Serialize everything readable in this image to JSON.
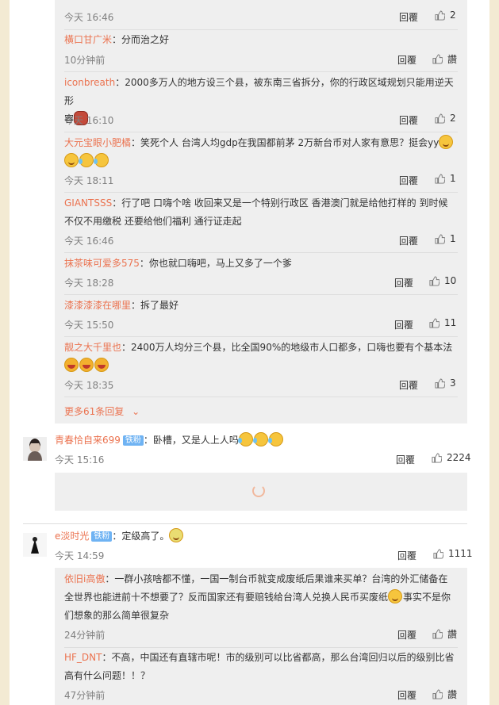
{
  "labels": {
    "reply": "回覆",
    "like": "讚"
  },
  "replies1": [
    {
      "user": "",
      "text": "",
      "time": "今天 16:46",
      "likes": "2"
    },
    {
      "user": "橫口甘广米",
      "text": "：分而治之好",
      "time": "10分钟前",
      "likes": "讚"
    },
    {
      "user": "iconbreath",
      "text": "：2000多万人的地方设三个县，被东南三省拆分，你的行政区域规划只能用逆天形",
      "text2": "容",
      "time": "今天 16:10",
      "likes": "2"
    },
    {
      "user": "大元宝眼小肥橘",
      "text": "：笑死个人 台湾人均gdp在我国都前茅 2万新台币对人家有意思？挺会yy",
      "time": "今天 18:11",
      "likes": "1"
    },
    {
      "user": "GIANTSSS",
      "text": "：行了吧  口嗨个啥  收回来又是一个特别行政区 香港澳门就是给他打样的  到时候",
      "text2": "不仅不用缴税 还要给他们福利  通行证走起",
      "time": "今天 16:46",
      "likes": "1"
    },
    {
      "user": "抹茶味可爱多575",
      "text": "：你也就口嗨吧，马上又多了一个爹",
      "time": "今天 18:28",
      "likes": "10"
    },
    {
      "user": "漆漆漆漆在哪里",
      "text": "：拆了最好",
      "time": "今天 15:50",
      "likes": "11"
    },
    {
      "user": "靓之大千里也",
      "text": "：2400万人均分三个县，比全国90%的地级市人口都多，口嗨也要有个基本法",
      "time": "今天 18:35",
      "likes": "3"
    }
  ],
  "more_replies": "更多61条回复",
  "comment1": {
    "user": "青春恰自来699",
    "badge": "铁粉",
    "text": "：卧槽，又是人上人吗",
    "time": "今天 15:16",
    "likes": "2224"
  },
  "comment2": {
    "user": "e淡时光",
    "badge": "铁粉",
    "text": "：定级高了。",
    "time": "今天 14:59",
    "likes": "1111"
  },
  "replies2": [
    {
      "user": "依旧i高傲",
      "text": "：一群小孩啥都不懂，一国一制台币就变成废纸后果谁来买单？台湾的外汇储备在",
      "text2": "全世界也能进前十不想要了？反而国家还有要赔钱给台湾人兑换人民币买废纸",
      "text2b": "事实不是你",
      "text3": "们想象的那么简单很复杂",
      "time": "24分钟前",
      "likes": "讚"
    },
    {
      "user": "HF_DNT",
      "text": "：不高，中国还有直辖市呢！市的级别可以比省都高，那么台湾回归以后的级别比省",
      "text2": "高有什么问题！！？",
      "time": "47分钟前",
      "likes": "讚"
    }
  ]
}
